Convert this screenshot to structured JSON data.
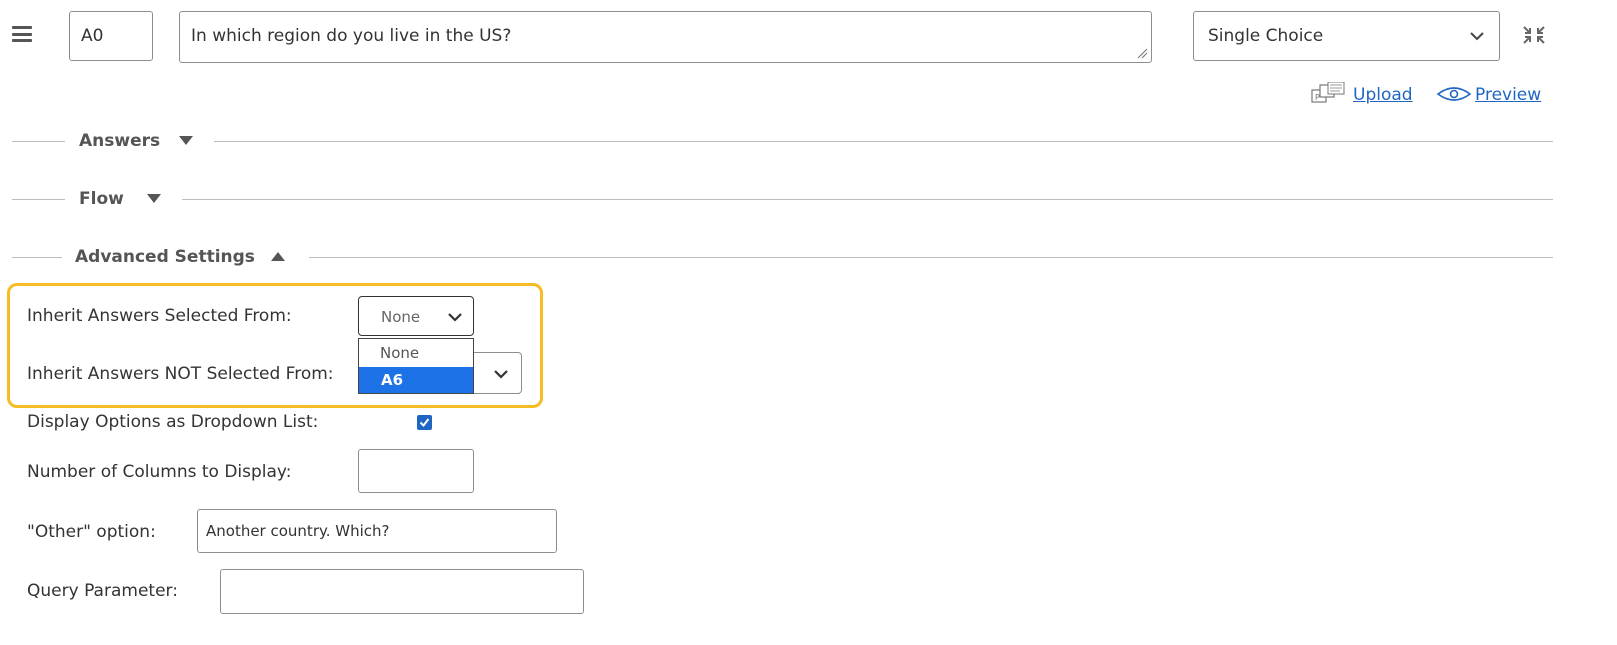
{
  "header": {
    "question_code": "A0",
    "question_text": "In which region do you live in the US?",
    "question_type": "Single Choice"
  },
  "actions": {
    "upload_label": "Upload",
    "preview_label": "Preview"
  },
  "sections": {
    "answers": "Answers",
    "flow": "Flow",
    "advanced": "Advanced Settings"
  },
  "advanced": {
    "inherit_selected_label": "Inherit Answers Selected From:",
    "inherit_selected_value": "None",
    "inherit_not_selected_label": "Inherit Answers NOT Selected From:",
    "dropdown_options": [
      "None",
      "A6"
    ],
    "dropdown_highlighted": "A6",
    "display_dropdown_label": "Display Options as Dropdown List:",
    "display_dropdown_checked": true,
    "columns_label": "Number of Columns to Display:",
    "columns_value": "",
    "other_label": "\"Other\" option:",
    "other_value": "Another country. Which?",
    "query_label": "Query Parameter:",
    "query_value": ""
  },
  "colors": {
    "link": "#1f66c4",
    "highlight_border": "#f5bd23",
    "selected_option": "#1e72e8"
  }
}
